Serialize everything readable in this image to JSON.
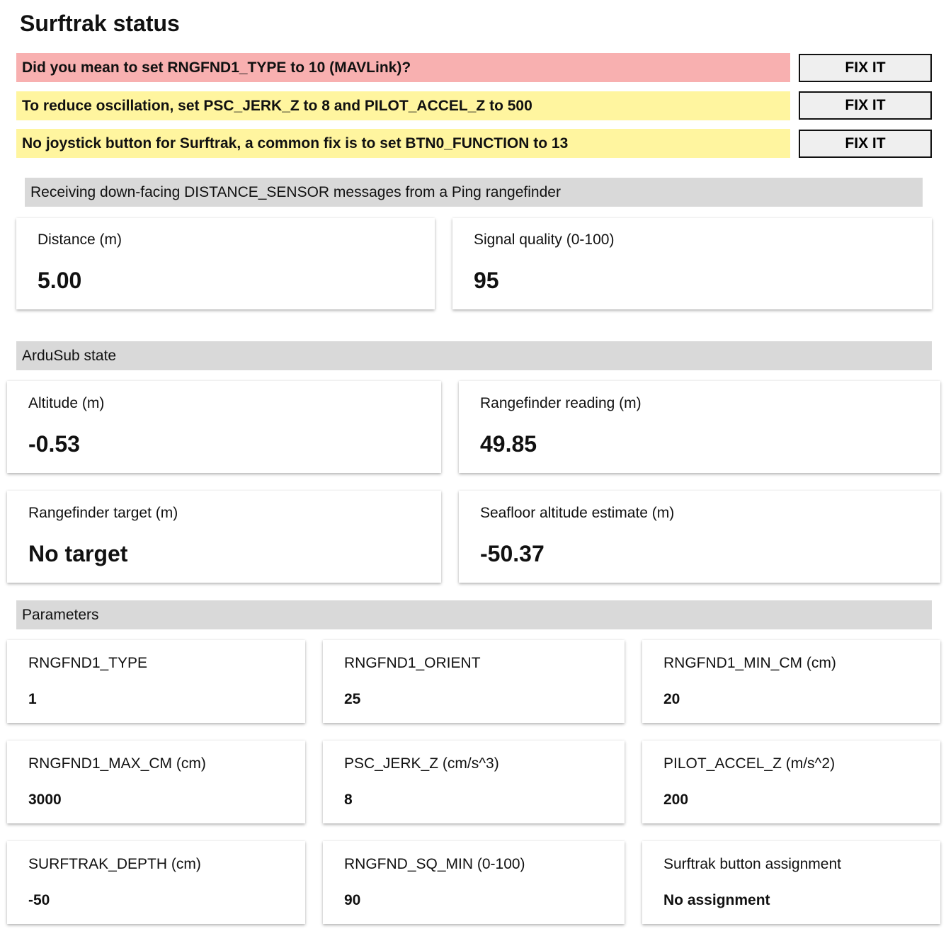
{
  "title": "Surftrak status",
  "alerts": [
    {
      "text": "Did you mean to set RNGFND1_TYPE to 10 (MAVLink)?",
      "severity": "error",
      "color": "#f8b0b0",
      "button": "FIX IT"
    },
    {
      "text": "To reduce oscillation, set PSC_JERK_Z to 8 and PILOT_ACCEL_Z to 500",
      "severity": "warning",
      "color": "#fff59f",
      "button": "FIX IT"
    },
    {
      "text": "No joystick button for Surftrak, a common fix is to set BTN0_FUNCTION to 13",
      "severity": "warning",
      "color": "#fff59f",
      "button": "FIX IT"
    }
  ],
  "rangefinder_section": {
    "heading": "Receiving down-facing DISTANCE_SENSOR messages from a Ping rangefinder",
    "cards": [
      {
        "label": "Distance (m)",
        "value": "5.00"
      },
      {
        "label": "Signal quality (0-100)",
        "value": "95"
      }
    ]
  },
  "ardusub_section": {
    "heading": "ArduSub state",
    "cards": [
      {
        "label": "Altitude (m)",
        "value": "-0.53"
      },
      {
        "label": "Rangefinder reading (m)",
        "value": "49.85"
      },
      {
        "label": "Rangefinder target (m)",
        "value": "No target"
      },
      {
        "label": "Seafloor altitude estimate (m)",
        "value": "-50.37"
      }
    ]
  },
  "parameters_section": {
    "heading": "Parameters",
    "cards": [
      {
        "label": "RNGFND1_TYPE",
        "value": "1"
      },
      {
        "label": "RNGFND1_ORIENT",
        "value": "25"
      },
      {
        "label": "RNGFND1_MIN_CM (cm)",
        "value": "20"
      },
      {
        "label": "RNGFND1_MAX_CM (cm)",
        "value": "3000"
      },
      {
        "label": "PSC_JERK_Z (cm/s^3)",
        "value": "8"
      },
      {
        "label": "PILOT_ACCEL_Z (m/s^2)",
        "value": "200"
      },
      {
        "label": "SURFTRAK_DEPTH (cm)",
        "value": "-50"
      },
      {
        "label": "RNGFND_SQ_MIN (0-100)",
        "value": "90"
      },
      {
        "label": "Surftrak button assignment",
        "value": "No assignment"
      }
    ]
  },
  "colors": {
    "section_bar": "#d9d9d9",
    "button_bg": "#efefef"
  }
}
